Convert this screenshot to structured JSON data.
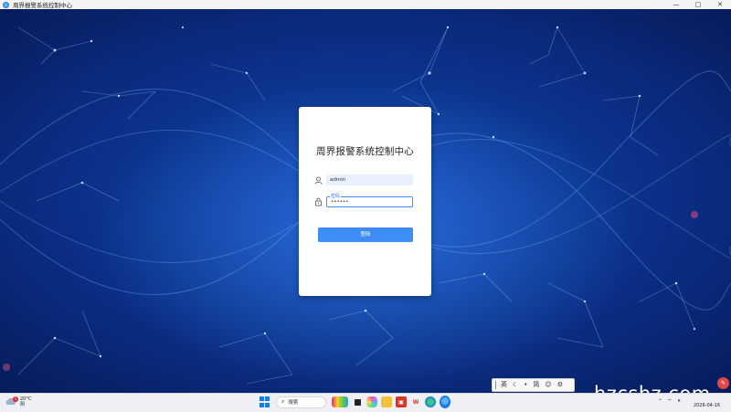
{
  "window": {
    "title": "周界报警系统控制中心",
    "controls": [
      "—",
      "□",
      "✕"
    ]
  },
  "login": {
    "title": "周界报警系统控制中心",
    "username_value": "admin",
    "password_label": "密码",
    "password_value": "••••••",
    "submit_label": "登陆"
  },
  "ime": {
    "items": [
      "英",
      "☾",
      "•",
      "简",
      "☺",
      "⚙"
    ]
  },
  "taskbar": {
    "weather_temp": "20°C",
    "weather_desc": "阴",
    "weather_badge": "1",
    "search_label": "搜索",
    "date": "2026-04-16"
  },
  "watermark": "hzcshz.com",
  "colors": {
    "accent": "#3d8df5",
    "focus_border": "#3b8cff",
    "desktop_blue": "#0b2f86"
  }
}
